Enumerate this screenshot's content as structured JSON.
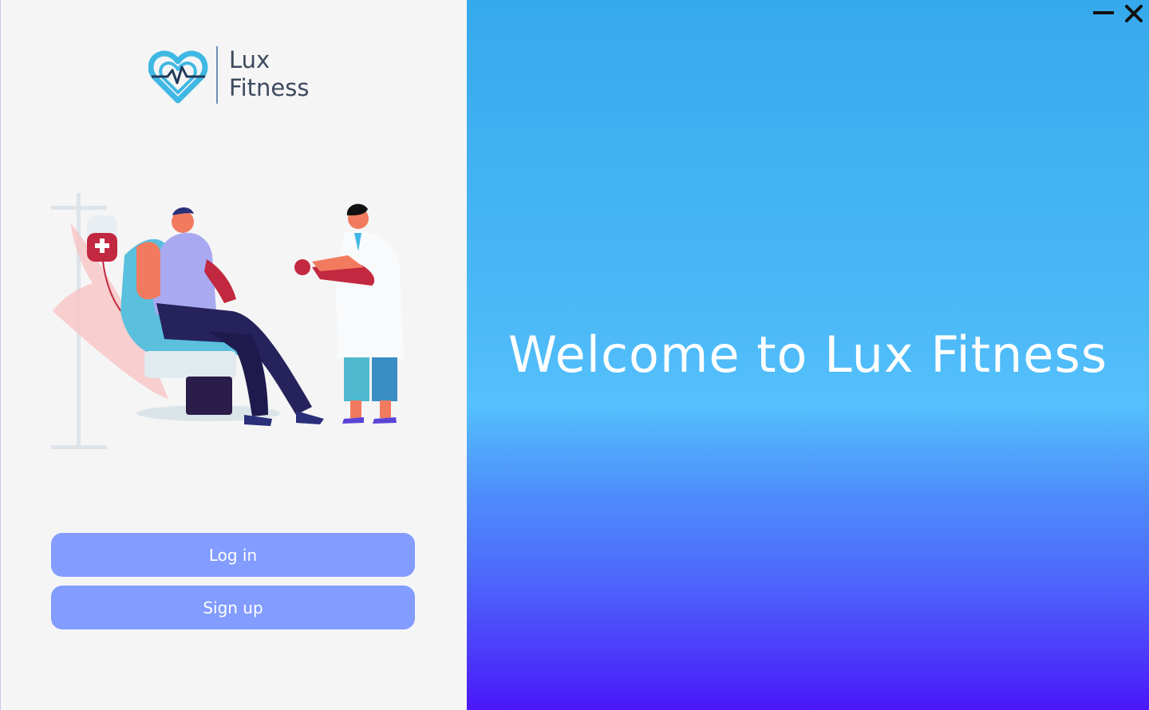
{
  "brand": {
    "line1": "Lux",
    "line2": "Fitness",
    "logo_icon": "heart-pulse-icon",
    "logo_color": "#3fb8e3"
  },
  "buttons": {
    "login_label": "Log in",
    "signup_label": "Sign up",
    "color": "#829cff"
  },
  "hero": {
    "welcome_text": "Welcome to Lux Fitness"
  },
  "window_controls": {
    "minimize_icon": "minimize-icon",
    "close_icon": "close-icon"
  },
  "illustration": {
    "subject": "blood-donation-illustration"
  }
}
